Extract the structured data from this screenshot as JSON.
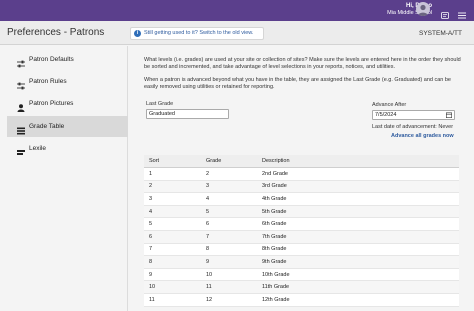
{
  "header": {
    "greeting": "Hi, Demo",
    "school": "Mia Middle School",
    "icons": [
      "avatar",
      "message-icon",
      "menu-icon"
    ]
  },
  "titlebar": {
    "title": "Preferences - Patrons",
    "notice": "Still getting used to it? Switch to the old view.",
    "code": "SYSTEM-A/TT"
  },
  "sidebar": {
    "items": [
      {
        "label": "Patron Defaults",
        "icon": "sliders-icon",
        "active": false
      },
      {
        "label": "Patron Rules",
        "icon": "sliders-icon",
        "active": false
      },
      {
        "label": "Patron Pictures",
        "icon": "person-icon",
        "active": false
      },
      {
        "label": "Grade Table",
        "icon": "table-icon",
        "active": true
      },
      {
        "label": "Lexile",
        "icon": "bookmark-icon",
        "active": false
      }
    ]
  },
  "main": {
    "intro": "What levels (i.e. grades) are used at your site or collection of sites? Make sure the levels are entered here in the order they should be sorted and incremented, and take advantage of level selections in your reports, notices, and utilities.",
    "advance_note": "When a patron is advanced beyond what you have in the table, they are assigned the Last Grade (e.g. Graduated) and can be easily removed using utilities or retained for reporting.",
    "last_grade_label": "Last Grade",
    "last_grade_value": "Graduated",
    "advance_after_label": "Advance After",
    "advance_after_value": "7/5/2024",
    "last_advancement": "Last date of advancement: Never",
    "advance_all_link": "Advance all grades now"
  },
  "grade_table": {
    "headers": [
      "Sort",
      "Grade",
      "Description"
    ],
    "rows": [
      [
        "1",
        "2",
        "2nd Grade"
      ],
      [
        "2",
        "3",
        "3rd Grade"
      ],
      [
        "3",
        "4",
        "4th Grade"
      ],
      [
        "4",
        "5",
        "5th Grade"
      ],
      [
        "5",
        "6",
        "6th Grade"
      ],
      [
        "6",
        "7",
        "7th Grade"
      ],
      [
        "7",
        "8",
        "8th Grade"
      ],
      [
        "8",
        "9",
        "9th Grade"
      ],
      [
        "9",
        "10",
        "10th Grade"
      ],
      [
        "10",
        "11",
        "11th Grade"
      ],
      [
        "11",
        "12",
        "12th Grade"
      ]
    ]
  },
  "colors": {
    "topbar": "#5b3f8c",
    "link": "#2e5b9e",
    "active_item": "#d9d9d9"
  }
}
